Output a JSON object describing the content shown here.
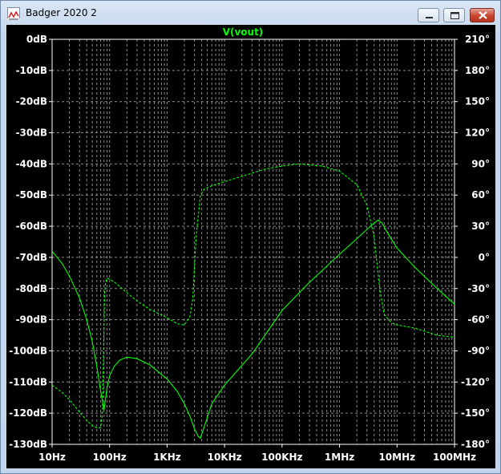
{
  "window": {
    "title": "Badger 2020 2",
    "icons": {
      "app": "waveform-app-icon",
      "minimize": "minimize-icon",
      "maximize": "maximize-icon",
      "close": "close-icon"
    }
  },
  "colors": {
    "trace": "#00ff00",
    "plot_bg": "#000000",
    "grid": "#8a8a8a",
    "axis_text": "#ffffff",
    "frame": "#ffffff"
  },
  "chart_data": {
    "type": "line",
    "title": "V(vout)",
    "x_scale": "log",
    "xlim": [
      10,
      100000000
    ],
    "x_ticks": [
      {
        "value": 10,
        "label": "10Hz"
      },
      {
        "value": 100,
        "label": "100Hz"
      },
      {
        "value": 1000,
        "label": "1KHz"
      },
      {
        "value": 10000,
        "label": "10KHz"
      },
      {
        "value": 100000,
        "label": "100KHz"
      },
      {
        "value": 1000000,
        "label": "1MHz"
      },
      {
        "value": 10000000,
        "label": "10MHz"
      },
      {
        "value": 100000000,
        "label": "100MHz"
      }
    ],
    "ylim_left": [
      -130,
      0
    ],
    "y_ticks_left": [
      {
        "value": 0,
        "label": "0dB"
      },
      {
        "value": -10,
        "label": "-10dB"
      },
      {
        "value": -20,
        "label": "-20dB"
      },
      {
        "value": -30,
        "label": "-30dB"
      },
      {
        "value": -40,
        "label": "-40dB"
      },
      {
        "value": -50,
        "label": "-50dB"
      },
      {
        "value": -60,
        "label": "-60dB"
      },
      {
        "value": -70,
        "label": "-70dB"
      },
      {
        "value": -80,
        "label": "-80dB"
      },
      {
        "value": -90,
        "label": "-90dB"
      },
      {
        "value": -100,
        "label": "-100dB"
      },
      {
        "value": -110,
        "label": "-110dB"
      },
      {
        "value": -120,
        "label": "-120dB"
      },
      {
        "value": -130,
        "label": "-130dB"
      }
    ],
    "ylim_right": [
      -180,
      210
    ],
    "y_ticks_right": [
      {
        "value": 210,
        "label": "210°"
      },
      {
        "value": 180,
        "label": "180°"
      },
      {
        "value": 150,
        "label": "150°"
      },
      {
        "value": 120,
        "label": "120°"
      },
      {
        "value": 90,
        "label": "90°"
      },
      {
        "value": 60,
        "label": "60°"
      },
      {
        "value": 30,
        "label": "30°"
      },
      {
        "value": 0,
        "label": "0°"
      },
      {
        "value": -30,
        "label": "-30°"
      },
      {
        "value": -60,
        "label": "-60°"
      },
      {
        "value": -90,
        "label": "-90°"
      },
      {
        "value": -120,
        "label": "-120°"
      },
      {
        "value": -150,
        "label": "-150°"
      },
      {
        "value": -180,
        "label": "-180°"
      }
    ],
    "grid": true,
    "series": [
      {
        "quantity": "magnitude",
        "axis": "left",
        "style": "solid",
        "x": [
          10,
          15,
          20,
          30,
          40,
          50,
          60,
          70,
          80,
          90,
          100,
          120,
          150,
          200,
          300,
          500,
          1000,
          1500,
          2000,
          2500,
          3000,
          3500,
          3800,
          4500,
          6000,
          10000,
          30000,
          100000,
          300000,
          1000000,
          2000000,
          3000000,
          4000000,
          4700000,
          5500000,
          7000000,
          10000000,
          20000000,
          50000000,
          100000000
        ],
        "y": [
          -68,
          -72,
          -76,
          -83,
          -90,
          -97,
          -105,
          -113,
          -119,
          -112,
          -108,
          -105,
          -103,
          -102,
          -102.5,
          -104.5,
          -109,
          -113,
          -117,
          -121,
          -125,
          -127.5,
          -128,
          -124,
          -117,
          -111,
          -101,
          -87,
          -78,
          -69,
          -64,
          -61,
          -59,
          -58,
          -59,
          -62.5,
          -67,
          -73,
          -80,
          -85
        ]
      },
      {
        "quantity": "phase",
        "axis": "right",
        "style": "dashed",
        "x": [
          10,
          15,
          20,
          30,
          40,
          50,
          60,
          70,
          75,
          78,
          80,
          82,
          85,
          90,
          100,
          130,
          200,
          300,
          500,
          1000,
          1500,
          2000,
          2500,
          2800,
          3200,
          3800,
          4500,
          6000,
          10000,
          20000,
          50000,
          100000,
          200000,
          500000,
          1000000,
          2000000,
          3000000,
          4000000,
          5000000,
          6000000,
          8000000,
          10000000,
          20000000,
          50000000,
          100000000
        ],
        "y": [
          -123,
          -130,
          -137,
          -149,
          -157,
          -162,
          -164,
          -164,
          -150,
          -100,
          -65,
          -35,
          -24,
          -20,
          -21,
          -25,
          -34,
          -42,
          -50,
          -58,
          -64,
          -65,
          -57,
          -40,
          20,
          60,
          66,
          69,
          73,
          78,
          85,
          88,
          90,
          88,
          83,
          70,
          50,
          20,
          -30,
          -55,
          -63,
          -65,
          -68,
          -75,
          -77
        ]
      }
    ]
  }
}
